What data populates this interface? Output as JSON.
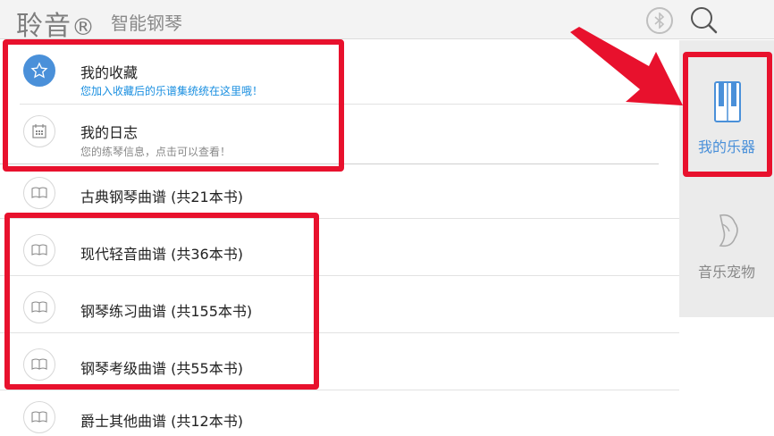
{
  "header": {
    "brand": "聆音",
    "brand_mark": "®",
    "subtitle": "智能钢琴",
    "bluetooth_icon": "bluetooth-icon",
    "search_icon": "search-icon"
  },
  "list": {
    "items": [
      {
        "title": "我的收藏",
        "desc": "您加入收藏后的乐谱集统统在这里哦！",
        "icon": "star-icon"
      },
      {
        "title": "我的日志",
        "desc": "您的练琴信息，点击可以查看！",
        "icon": "calendar-icon"
      },
      {
        "title": "古典钢琴曲谱 (共21本书)",
        "icon": "book-icon"
      },
      {
        "title": "现代轻音曲谱 (共36本书)",
        "icon": "book-icon"
      },
      {
        "title": "钢琴练习曲谱 (共155本书)",
        "icon": "book-icon"
      },
      {
        "title": "钢琴考级曲谱 (共55本书)",
        "icon": "book-icon"
      },
      {
        "title": "爵士其他曲谱 (共12本书)",
        "icon": "book-icon"
      }
    ]
  },
  "sidebar": {
    "items": [
      {
        "label": "我的乐器",
        "icon": "piano-icon",
        "active": true
      },
      {
        "label": "音乐宠物",
        "icon": "pet-icon",
        "active": false
      }
    ]
  },
  "colors": {
    "highlight": "#e8112d",
    "accent": "#4a90d9",
    "desc_blue": "#1a8fe0",
    "desc_gray": "#888888"
  }
}
